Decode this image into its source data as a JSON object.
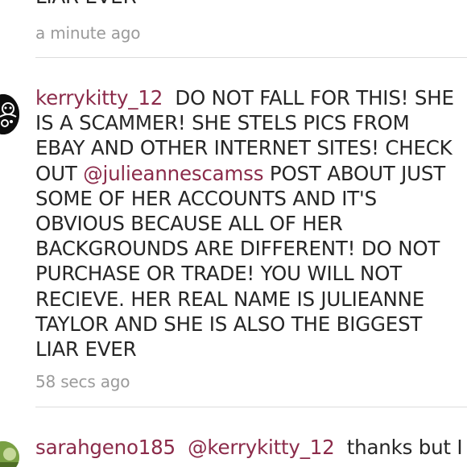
{
  "comments": [
    {
      "text_tail": "LIAR EVER",
      "timestamp": "a minute ago"
    },
    {
      "username": "kerrykitty_12",
      "text_before_mention": "DO NOT FALL FOR THIS! SHE IS A SCAMMER! SHE STELS PICS FROM EBAY AND OTHER INTERNET SITES! CHECK OUT",
      "mention": "@julieannescamss",
      "text_after_mention": "POST ABOUT JUST SOME OF HER ACCOUNTS AND IT'S OBVIOUS BECAUSE ALL OF HER BACKGROUNDS ARE DIFFERENT! DO NOT PURCHASE OR TRADE! YOU WILL NOT RECIEVE. HER REAL NAME IS JULIEANNE TAYLOR AND SHE IS ALSO THE BIGGEST LIAR EVER",
      "timestamp": "58 secs ago",
      "avatar_icon": "cat-avatar-icon"
    },
    {
      "username": "sarahgeno185",
      "mention": "@kerrykitty_12",
      "text": "thanks but I",
      "avatar_icon": "green-avatar-icon"
    }
  ]
}
